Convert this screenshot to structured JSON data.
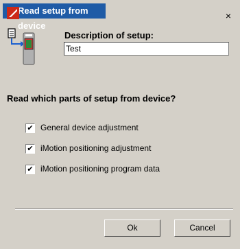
{
  "window": {
    "title": "Read setup from device",
    "close": "×"
  },
  "description": {
    "label": "Description of setup:",
    "value": "Test"
  },
  "parts": {
    "heading": "Read which parts of setup from device?",
    "options": [
      {
        "label": "General device adjustment",
        "checked": true
      },
      {
        "label": "iMotion positioning adjustment",
        "checked": true
      },
      {
        "label": "iMotion positioning program data",
        "checked": true
      }
    ]
  },
  "buttons": {
    "ok": "Ok",
    "cancel": "Cancel"
  },
  "colors": {
    "titlebar": "#1f5ba6",
    "dialog": "#d4d0c8"
  }
}
